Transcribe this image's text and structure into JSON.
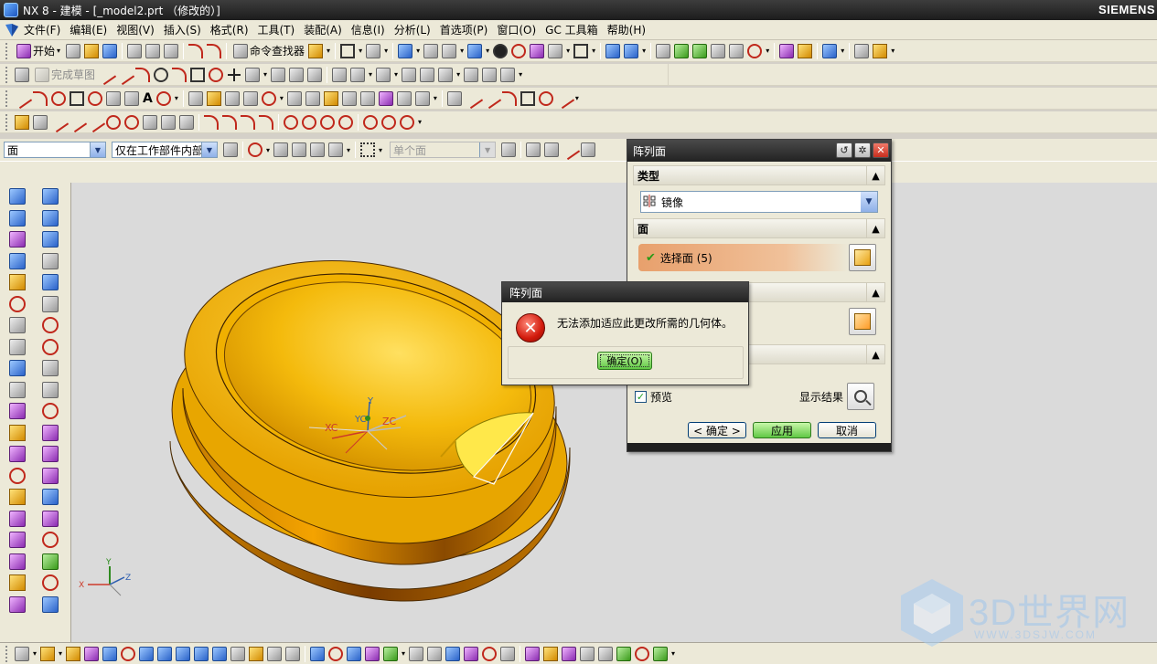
{
  "window": {
    "title": "NX 8 - 建模 - [_model2.prt （修改的）]",
    "brand": "SIEMENS"
  },
  "menu": {
    "items": [
      "文件(F)",
      "编辑(E)",
      "视图(V)",
      "插入(S)",
      "格式(R)",
      "工具(T)",
      "装配(A)",
      "信息(I)",
      "分析(L)",
      "首选项(P)",
      "窗口(O)",
      "GC 工具箱",
      "帮助(H)"
    ]
  },
  "toolbar": {
    "start_label": "开始",
    "command_finder_label": "命令查找器",
    "finish_sketch_label": "完成草图"
  },
  "selection": {
    "filter_type": "面",
    "scope": "仅在工作部件内部",
    "face_rule": "单个面"
  },
  "pattern_dialog": {
    "title": "阵列面",
    "type_header": "类型",
    "type_value": "镜像",
    "face_header": "面",
    "select_face_label": "选择面 (5)",
    "preview_label": "预览",
    "show_result_label": "显示结果",
    "ok_label": "< 确定 >",
    "apply_label": "应用",
    "cancel_label": "取消"
  },
  "error_dialog": {
    "title": "阵列面",
    "message": "无法添加适应此更改所需的几何体。",
    "ok_label": "确定(O)"
  },
  "csys": {
    "x": "XC",
    "y": "Y",
    "z": "ZC",
    "yc": "YC",
    "ax_x": "X",
    "ax_y": "Y",
    "ax_z": "Z"
  },
  "watermark": {
    "text": "3D世界网",
    "url": "WWW.3DSJW.COM"
  },
  "colors": {
    "accent": "#2a62c9",
    "part_yellow": "#f2b500",
    "title_bar": "#2a2a2a",
    "apply_green": "#60c844"
  }
}
